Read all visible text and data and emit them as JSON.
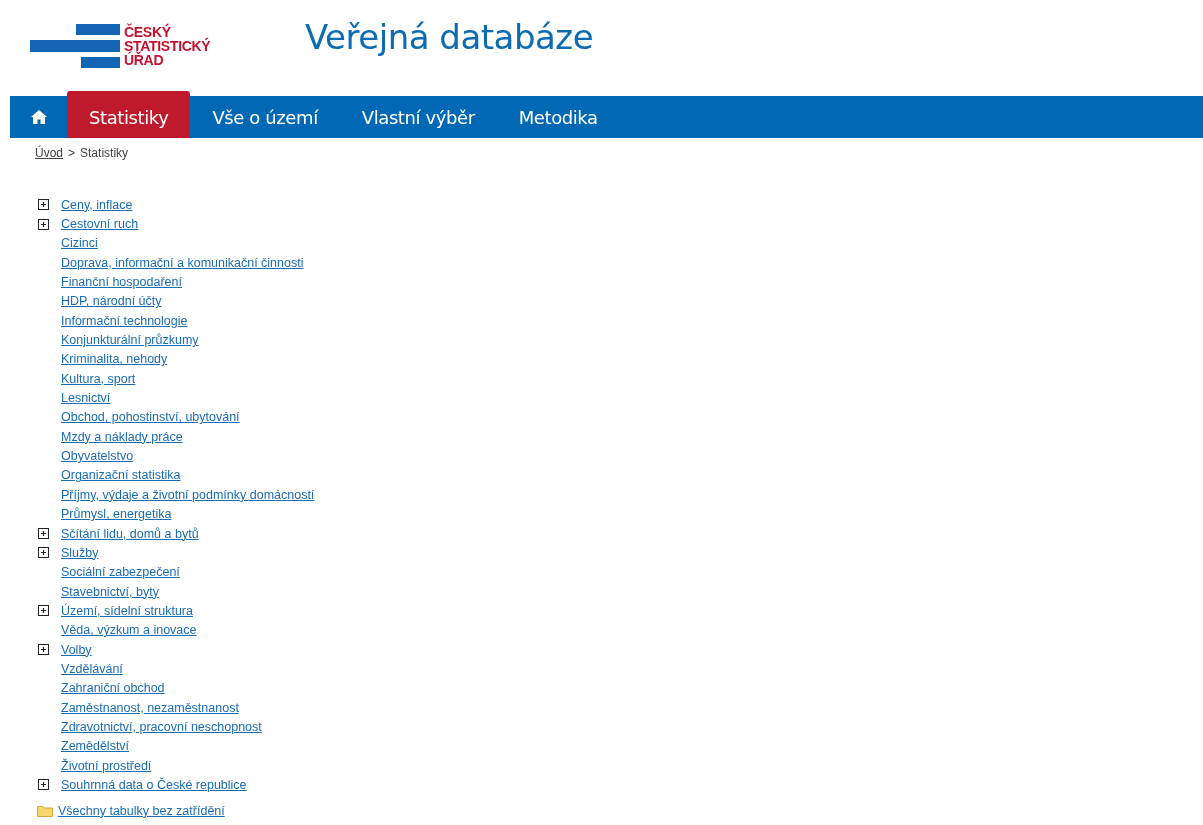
{
  "logo": {
    "lines": [
      "ČESKÝ",
      "STATISTICKÝ",
      "ÚŘAD"
    ]
  },
  "title": "Veřejná databáze",
  "nav": {
    "tabs": [
      {
        "label": "Statistiky",
        "selected": true
      },
      {
        "label": "Vše o území",
        "selected": false
      },
      {
        "label": "Vlastní výběr",
        "selected": false
      },
      {
        "label": "Metodika",
        "selected": false
      }
    ]
  },
  "breadcrumb": {
    "link": "Úvod",
    "separator": ">",
    "current": "Statistiky"
  },
  "topics": [
    {
      "label": "Ceny, inflace",
      "expandable": true
    },
    {
      "label": "Cestovní ruch",
      "expandable": true
    },
    {
      "label": "Cizinci",
      "expandable": false
    },
    {
      "label": "Doprava, informační a komunikační činnosti",
      "expandable": false
    },
    {
      "label": "Finanční hospodaření",
      "expandable": false
    },
    {
      "label": "HDP, národní účty",
      "expandable": false
    },
    {
      "label": "Informační technologie",
      "expandable": false
    },
    {
      "label": "Konjunkturální průzkumy",
      "expandable": false
    },
    {
      "label": "Kriminalita, nehody",
      "expandable": false
    },
    {
      "label": "Kultura, sport",
      "expandable": false
    },
    {
      "label": "Lesnictví",
      "expandable": false
    },
    {
      "label": "Obchod, pohostinství, ubytování",
      "expandable": false
    },
    {
      "label": "Mzdy a náklady práce",
      "expandable": false
    },
    {
      "label": "Obyvatelstvo",
      "expandable": false
    },
    {
      "label": "Organizační statistika",
      "expandable": false
    },
    {
      "label": "Příjmy, výdaje a životní podmínky domácností",
      "expandable": false
    },
    {
      "label": "Průmysl, energetika",
      "expandable": false
    },
    {
      "label": "Sčítání lidu, domů a bytů",
      "expandable": true
    },
    {
      "label": "Služby",
      "expandable": true
    },
    {
      "label": "Sociální zabezpečení",
      "expandable": false
    },
    {
      "label": "Stavebnictví, byty",
      "expandable": false
    },
    {
      "label": "Území, sídelní struktura",
      "expandable": true
    },
    {
      "label": "Věda, výzkum a inovace",
      "expandable": false
    },
    {
      "label": "Volby",
      "expandable": true
    },
    {
      "label": "Vzdělávání",
      "expandable": false
    },
    {
      "label": "Zahraniční obchod",
      "expandable": false
    },
    {
      "label": "Zaměstnanost, nezaměstnanost",
      "expandable": false
    },
    {
      "label": "Zdravotnictví, pracovní neschopnost",
      "expandable": false
    },
    {
      "label": "Zemědělství",
      "expandable": false
    },
    {
      "label": "Životní prostředí",
      "expandable": false
    },
    {
      "label": "Souhrnná data o České republice",
      "expandable": true
    }
  ],
  "all_tables": "Všechny tabulky bez zatřídění"
}
